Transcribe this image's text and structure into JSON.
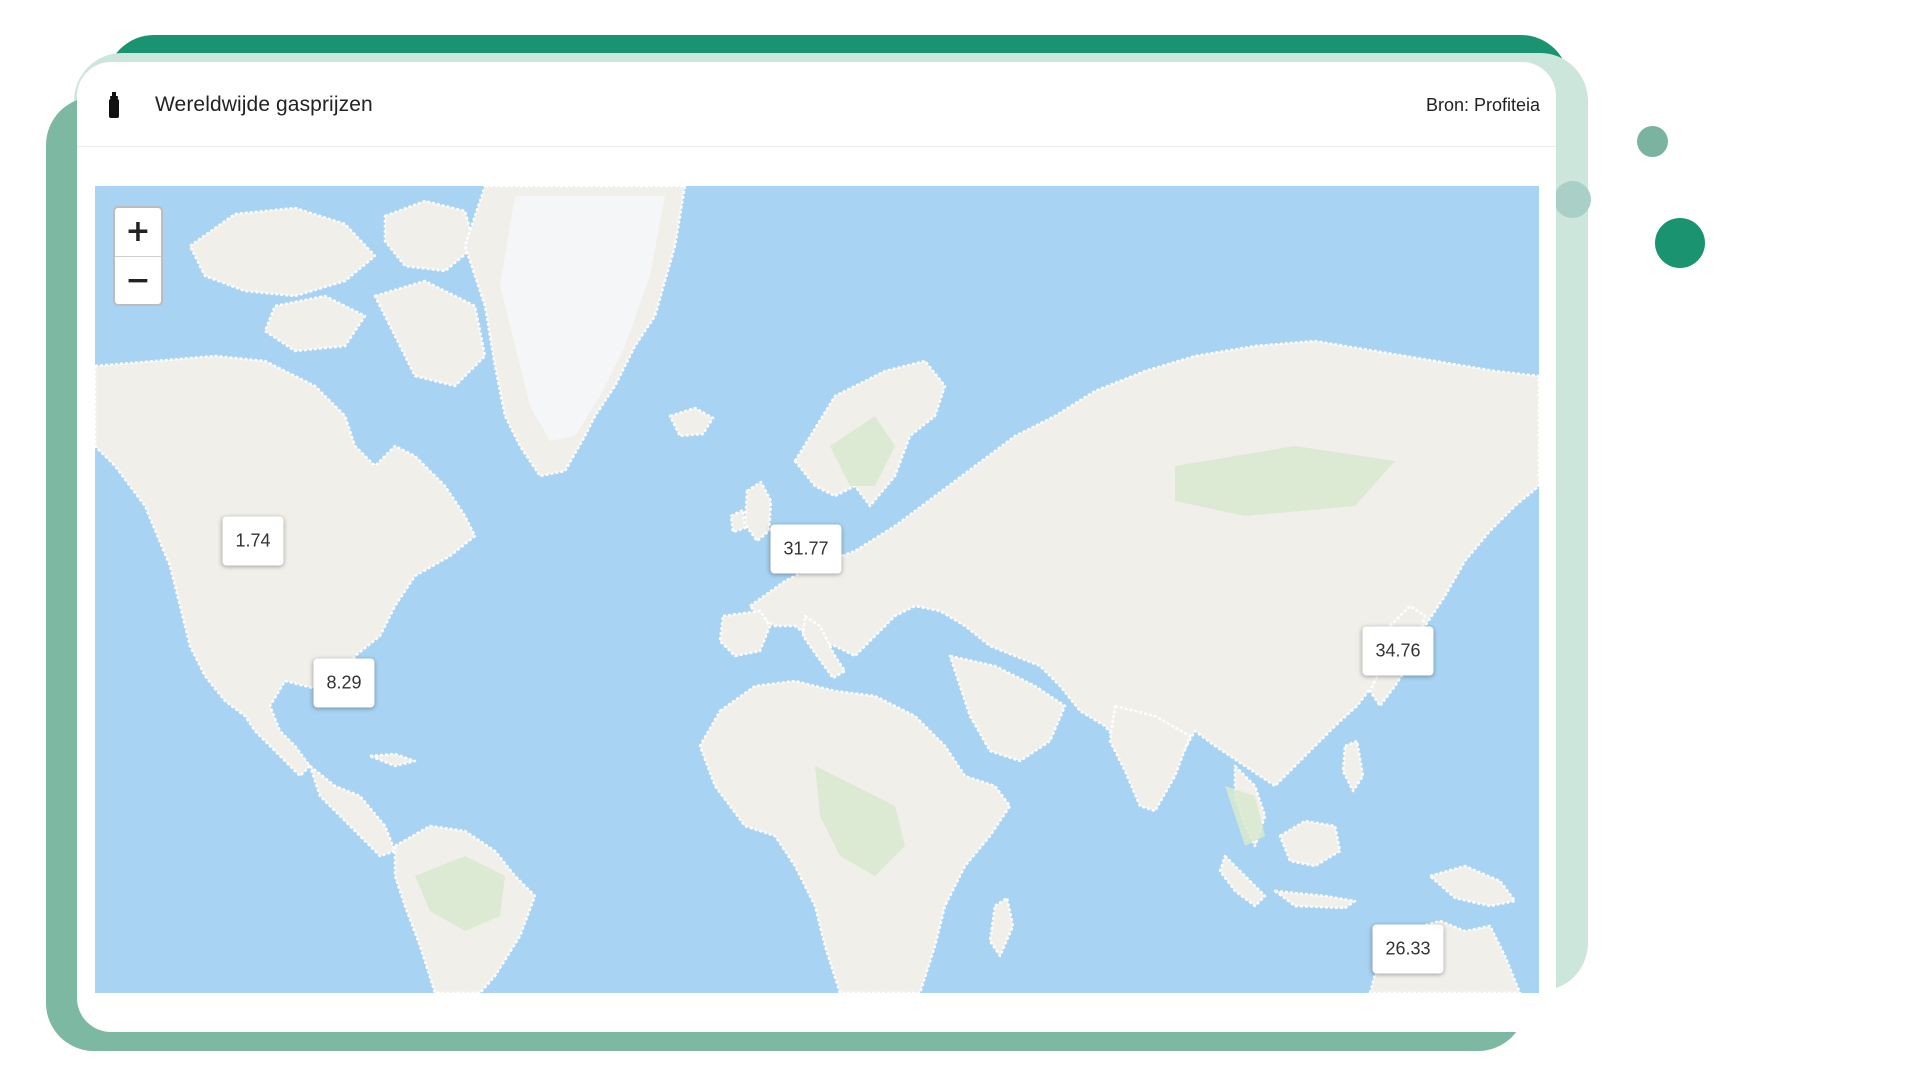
{
  "header": {
    "title": "Wereldwijde gasprijzen",
    "source": "Bron: Profiteia",
    "icon": "gas-bottle-icon"
  },
  "map": {
    "zoom_in_label": "+",
    "zoom_out_label": "−",
    "colors": {
      "water": "#a8d3f2",
      "land": "#f1efea",
      "vegetation": "#d9e9cf",
      "ice": "#f4f6f8"
    },
    "markers": [
      {
        "region": "Canada",
        "value": "1.74"
      },
      {
        "region": "Mexico",
        "value": "8.29"
      },
      {
        "region": "Europe",
        "value": "31.77"
      },
      {
        "region": "Japan",
        "value": "34.76"
      },
      {
        "region": "Australia",
        "value": "26.33"
      }
    ]
  },
  "colors": {
    "accent_dark": "#1a9370",
    "accent_mid": "#7db8a3",
    "accent_pale": "#cde6dc"
  }
}
